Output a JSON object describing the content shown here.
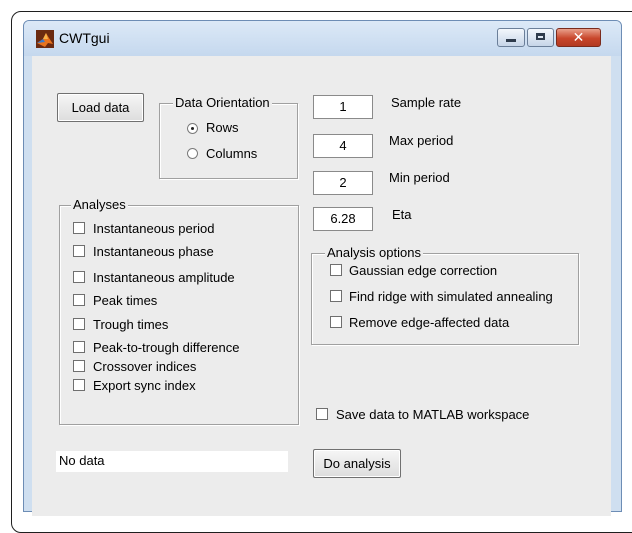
{
  "window": {
    "title": "CWTgui",
    "minimize_icon": "minimize-icon",
    "maximize_icon": "maximize-icon",
    "close_icon": "close-icon",
    "close_glyph": "✕"
  },
  "buttons": {
    "load_data": "Load data",
    "do_analysis": "Do analysis"
  },
  "orientation": {
    "title": "Data Orientation",
    "options": [
      "Rows",
      "Columns"
    ],
    "selected": "Rows"
  },
  "params": [
    {
      "value": "1",
      "label": "Sample rate"
    },
    {
      "value": "4",
      "label": "Max period"
    },
    {
      "value": "2",
      "label": "Min period"
    },
    {
      "value": "6.28",
      "label": "Eta"
    }
  ],
  "analyses": {
    "title": "Analyses",
    "items": [
      "Instantaneous period",
      "Instantaneous phase",
      "Instantaneous amplitude",
      "Peak times",
      "Trough times",
      "Peak-to-trough difference",
      "Crossover indices",
      "Export sync index"
    ]
  },
  "analysis_options": {
    "title": "Analysis options",
    "items": [
      "Gaussian edge correction",
      "Find ridge with simulated annealing",
      "Remove edge-affected data"
    ]
  },
  "save_workspace": "Save data to MATLAB workspace",
  "status_text": "No data",
  "colors": {
    "titlebar": "#cfdff0",
    "client_bg": "#ececec",
    "close_button": "#c8462b"
  }
}
